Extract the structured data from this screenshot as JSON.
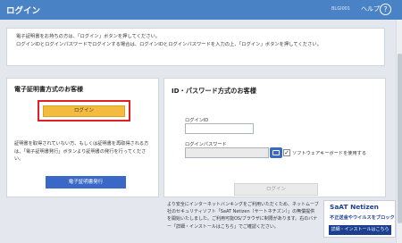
{
  "header": {
    "title": "ログイン",
    "code": "BLGI001",
    "help_label": "ヘルプ",
    "help_icon": "?"
  },
  "notice": {
    "line1": "電子証明書をお持ちの方は、「ログイン」ボタンを押してください。",
    "line2": "ログインIDとログインパスワードでログインする場合は、ログインIDとログインパスワードを入力の上、「ログイン」ボタンを押してください。"
  },
  "cert_panel": {
    "heading": "電子証明書方式のお客様",
    "login_label": "ログイン",
    "description": "証明書を取得されていない方、もしくは証明書を再取得される方は、「電子証明書発行」ボタンより証明書の発行を行ってください。",
    "issue_label": "電子証明書発行",
    "colors": {
      "login_button": "#f3bc3e",
      "highlight": "#e02020",
      "issue_button": "#3968c6"
    }
  },
  "id_panel": {
    "heading": "ID・パスワード方式のお客様",
    "id_label": "ログインID",
    "id_value": "",
    "pw_label": "ログインパスワード",
    "pw_value": "",
    "keyboard_icon": "keyboard-icon",
    "software_kb_label": "ソフトウェアキーボードを使用する",
    "software_kb_checked": true,
    "login_label": "ログイン"
  },
  "footer": {
    "text": "より安全にインターネットバンキングをご利用いただくため、ネットムーブ社のセキュリティソフト「SaAT Netizen（サートネチズン）」の無償提供を開始いたしました。ご利用可能OS/ブラウザに制限があります。右のバナー「詳細・インストールはこちら」でご確認ください。"
  },
  "banner": {
    "title": "SaAT Netizen",
    "subtitle": "不正送金やウイルスをブロック",
    "button_label": "詳細・インストールはこちら",
    "brand_color": "#1c3f90"
  },
  "theme": {
    "header_bg": "#4a82c6",
    "page_bg": "#e4e8ee"
  }
}
